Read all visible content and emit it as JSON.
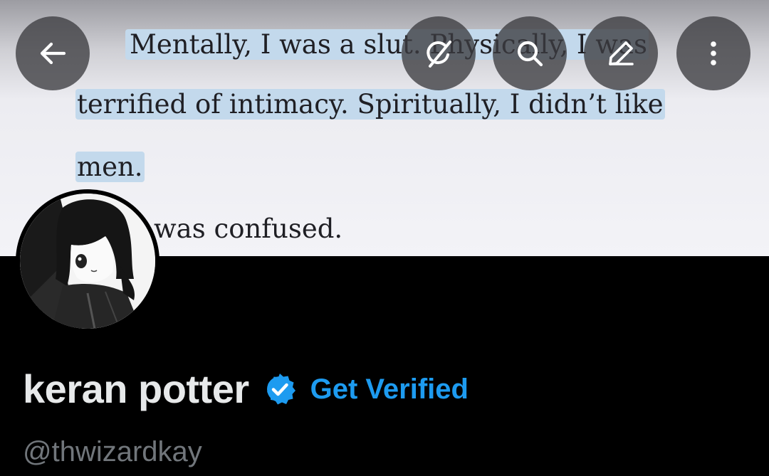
{
  "banner": {
    "text_lines": [
      "Mentally, I was a slut. Physically, I was",
      "terrified of intimacy. Spiritually, I didn’t like",
      "men.",
      "was confused."
    ],
    "highlight_color": "#c3d9ec"
  },
  "toolbar": {
    "back_icon": "arrow-left-icon",
    "grok_icon": "grok-icon",
    "search_icon": "search-icon",
    "edit_icon": "edit-pencil-icon",
    "more_icon": "more-vertical-icon"
  },
  "profile": {
    "display_name": "keran potter",
    "verified_icon": "verified-badge-icon",
    "get_verified_label": "Get Verified",
    "handle": "@thwizardkay",
    "accent_color": "#1d9bf0"
  }
}
